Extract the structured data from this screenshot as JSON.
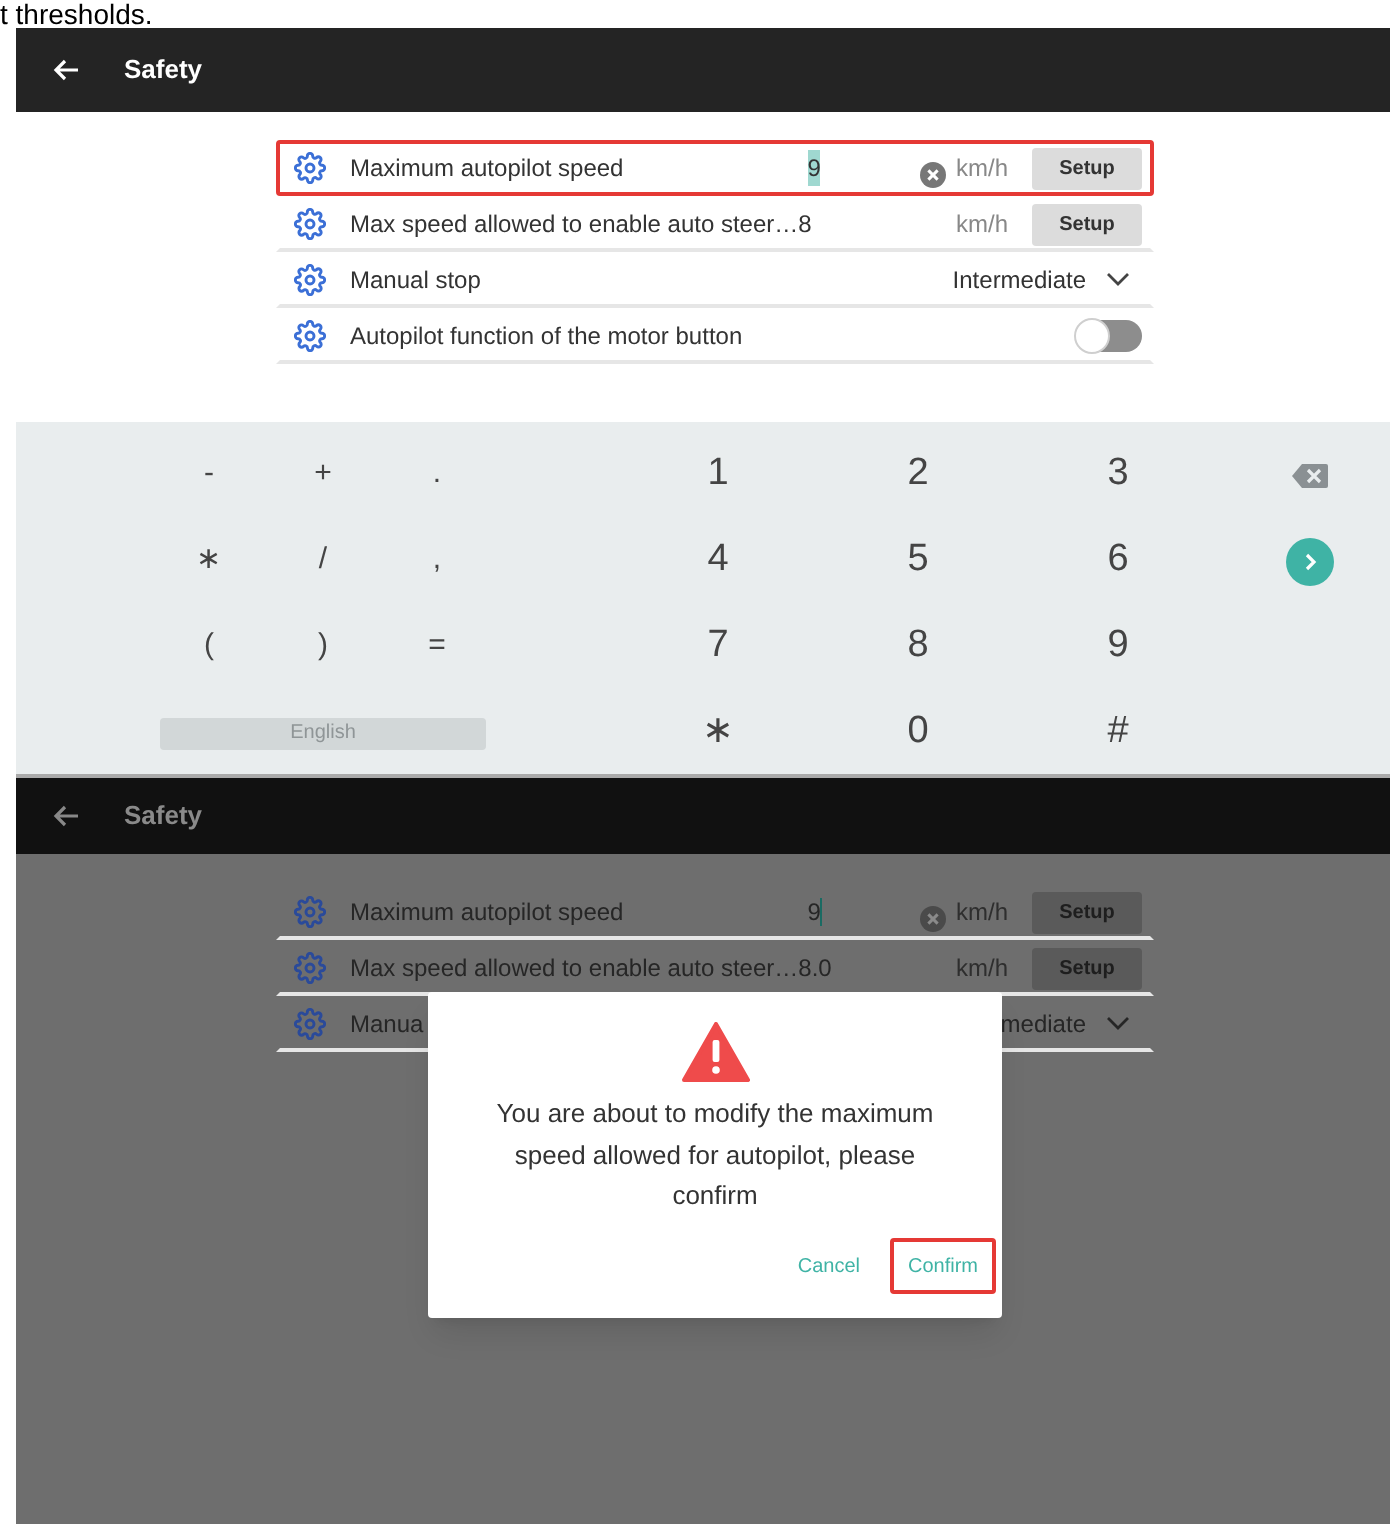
{
  "caption": "t thresholds.",
  "screens": [
    {
      "title": "Safety",
      "dimmed": false,
      "settings": [
        {
          "kind": "input",
          "label": "Maximum autopilot speed",
          "value": "9",
          "text_selected": true,
          "cursor": false,
          "clear_button": true,
          "unit": "km/h",
          "button": "Setup",
          "highlighted": true
        },
        {
          "kind": "input",
          "label": "Max speed allowed to enable auto steer…",
          "value": "8",
          "unit": "km/h",
          "button": "Setup",
          "highlighted": false
        },
        {
          "kind": "select",
          "label": "Manual stop",
          "value": "Intermediate",
          "highlighted": false
        },
        {
          "kind": "toggle",
          "label": "Autopilot function of the motor button",
          "on": false,
          "highlighted": false
        }
      ],
      "keyboard": [
        [
          {
            "kind": "char",
            "label": "-"
          },
          {
            "kind": "char",
            "label": "+"
          },
          {
            "kind": "char",
            "label": "."
          },
          {
            "kind": "char",
            "label": "1"
          },
          {
            "kind": "char",
            "label": "2"
          },
          {
            "kind": "char",
            "label": "3"
          },
          {
            "kind": "backspace"
          }
        ],
        [
          {
            "kind": "char",
            "label": "∗"
          },
          {
            "kind": "char",
            "label": "/"
          },
          {
            "kind": "char",
            "label": ","
          },
          {
            "kind": "char",
            "label": "4"
          },
          {
            "kind": "char",
            "label": "5"
          },
          {
            "kind": "char",
            "label": "6"
          },
          {
            "kind": "enter"
          }
        ],
        [
          {
            "kind": "char",
            "label": "("
          },
          {
            "kind": "char",
            "label": ")"
          },
          {
            "kind": "char",
            "label": "="
          },
          {
            "kind": "char",
            "label": "7"
          },
          {
            "kind": "char",
            "label": "8"
          },
          {
            "kind": "char",
            "label": "9"
          }
        ],
        [
          {
            "kind": "language",
            "label": "English"
          },
          {
            "kind": "char",
            "label": "∗"
          },
          {
            "kind": "char",
            "label": "0"
          },
          {
            "kind": "char",
            "label": "#"
          }
        ]
      ]
    },
    {
      "title": "Safety",
      "dimmed": true,
      "settings": [
        {
          "kind": "input",
          "label": "Maximum autopilot speed",
          "value": "9",
          "text_selected": false,
          "cursor": true,
          "clear_button": true,
          "unit": "km/h",
          "button": "Setup",
          "highlighted": false
        },
        {
          "kind": "input",
          "label": "Max speed allowed to enable auto steer…",
          "value": "8.0",
          "unit": "km/h",
          "button": "Setup",
          "highlighted": false
        },
        {
          "kind": "select",
          "label": "Manua",
          "value": "mediate",
          "highlighted": false
        }
      ],
      "dialog": {
        "message": "You are about to modify the maximum speed allowed for autopilot, please confirm",
        "buttons": [
          {
            "label": "Cancel",
            "highlighted": false
          },
          {
            "label": "Confirm",
            "highlighted": true
          }
        ]
      }
    }
  ]
}
